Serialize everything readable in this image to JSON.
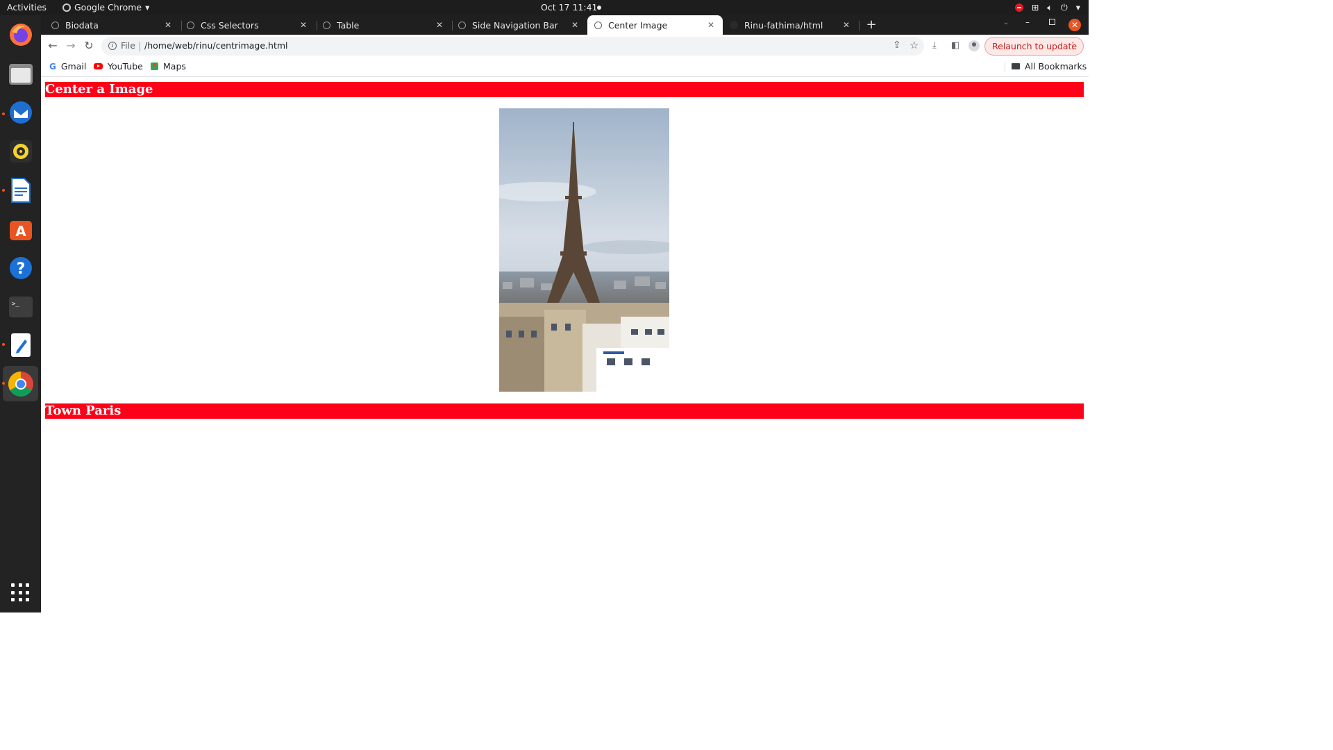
{
  "system": {
    "activities": "Activities",
    "app_name": "Google Chrome",
    "clock": "Oct 17  11:41"
  },
  "tabs": [
    {
      "label": "Biodata",
      "active": false
    },
    {
      "label": "Css Selectors",
      "active": false
    },
    {
      "label": "Table",
      "active": false
    },
    {
      "label": "Side Navigation Bar",
      "active": false
    },
    {
      "label": "Center Image",
      "active": true
    },
    {
      "label": "Rinu-fathima/html",
      "active": false
    }
  ],
  "address_bar": {
    "scheme_label": "File",
    "url": "/home/web/rinu/centrimage.html"
  },
  "relaunch_label": "Relaunch to update",
  "bookmarks": {
    "items": [
      "Gmail",
      "YouTube",
      "Maps"
    ],
    "all_bookmarks": "All Bookmarks"
  },
  "content": {
    "heading_top": "Center a Image",
    "heading_bottom": "Town Paris",
    "image_subject": "eiffel-tower-paris-skyline"
  },
  "colors": {
    "heading_bar": "#ff0019",
    "heading_text": "#ffffff",
    "relaunch_text": "#c5221f"
  }
}
